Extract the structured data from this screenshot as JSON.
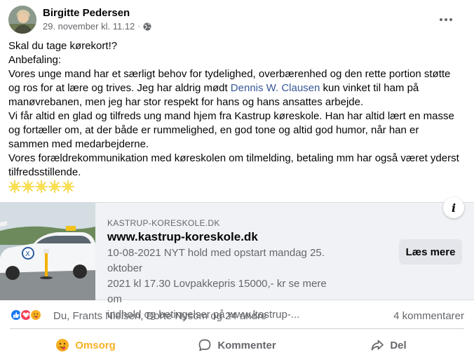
{
  "post": {
    "author": "Birgitte Pedersen",
    "timestamp": "29. november kl. 11.12",
    "separator": "·",
    "lines": {
      "l1": "Skal du tage kørekort!?",
      "l2": "Anbefaling:",
      "l3": "Vores unge mand har et særligt behov for tydelighed, overbærenhed og den rette portion støtte",
      "l4_pre": "og ros for at lære og trives. Jeg har aldrig mødt ",
      "l4_mention": "Dennis W. Clausen",
      "l4_post": " kun vinket til ham på",
      "l5": "manøvrebanen, men jeg har stor respekt for hans og hans ansattes arbejde.",
      "l6": "Vi får altid en glad og tilfreds ung mand hjem fra Kastrup køreskole. Han har altid lært en masse",
      "l7": "og fortæller om, at der både er rummelighed, en god tone og altid god humor, når han er",
      "l8": "sammen med medarbejderne.",
      "l9": "Vores forældrekommunikation med køreskolen om tilmelding, betaling mm har også været yderst",
      "l10": "tilfredsstillende."
    },
    "emoji_count": 5
  },
  "link_preview": {
    "domain": "KASTRUP-KORESKOLE.DK",
    "title": "www.kastrup-koreskole.dk",
    "desc_line1": "10-08-2021 NYT hold med opstart mandag 25. oktober",
    "desc_line2": "2021 kl 17.30 Lovpakkepris 15000,- kr se mere om",
    "desc_line3": "indhold og betingelser på www.kastrup-...",
    "info_label": "i",
    "cta_label": "Læs mere"
  },
  "reactions": {
    "names": "Du, Frants Nielsen, Dorte Nysom og 24 andre",
    "comments": "4 kommentarer"
  },
  "actions": {
    "care": "Omsorg",
    "comment": "Kommenter",
    "share": "Del"
  },
  "colors": {
    "mention": "#385898",
    "care_active": "#f7b125",
    "like_blue": "#1877f2",
    "love_red": "#f33e58"
  }
}
